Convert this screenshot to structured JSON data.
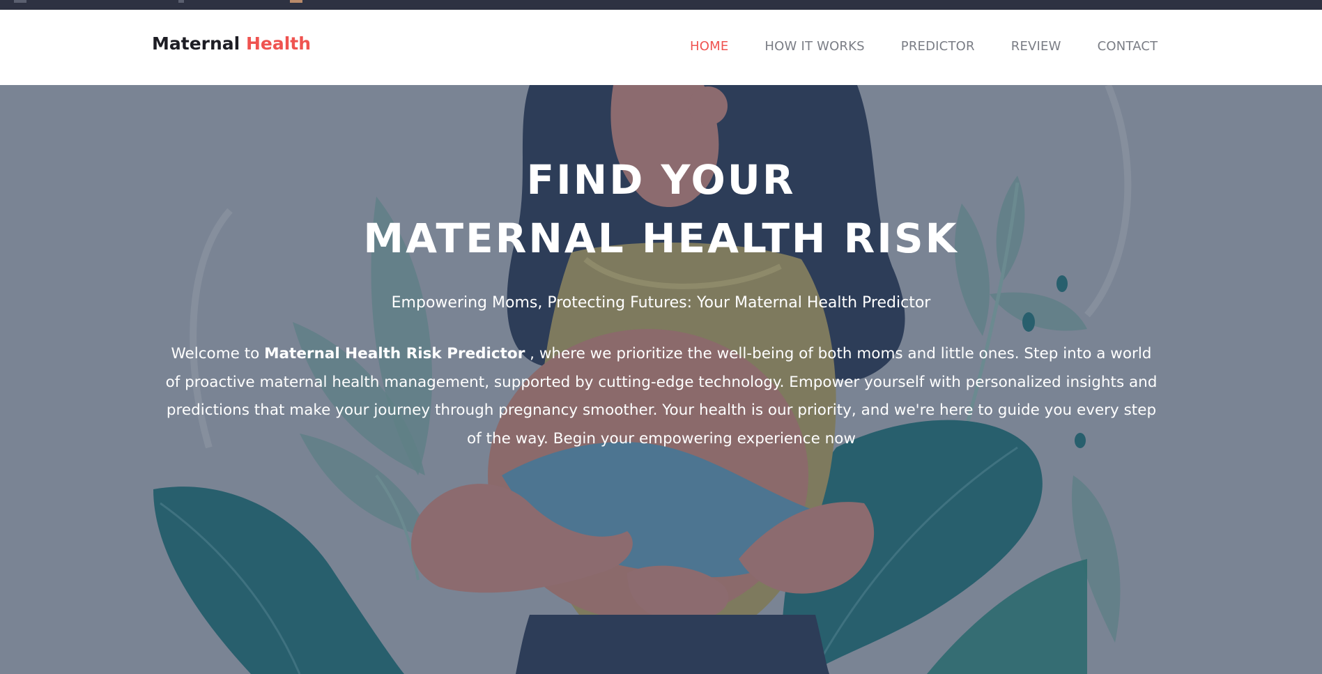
{
  "brand": {
    "name_part1": "Maternal",
    "name_part2": "Health"
  },
  "nav": {
    "items": [
      {
        "label": "HOME",
        "active": true
      },
      {
        "label": "HOW IT WORKS",
        "active": false
      },
      {
        "label": "PREDICTOR",
        "active": false
      },
      {
        "label": "REVIEW",
        "active": false
      },
      {
        "label": "CONTACT",
        "active": false
      }
    ]
  },
  "hero": {
    "title_line1": "FIND YOUR",
    "title_line2": "MATERNAL HEALTH RISK",
    "tagline": "Empowering Moms, Protecting Futures: Your Maternal Health Predictor",
    "intro_prefix": "Welcome to ",
    "intro_bold": "Maternal Health Risk Predictor",
    "intro_suffix": " , where we prioritize the well-being of both moms and little ones. Step into a world of proactive maternal health management, supported by cutting-edge technology. Empower yourself with personalized insights and predictions that make your journey through pregnancy smoother. Your health is our priority, and we're here to guide you every step of the way. Begin your empowering experience now"
  },
  "colors": {
    "accent": "#ef5350",
    "nav_text": "#7a7d85",
    "hero_overlay": "#7a8494",
    "brand_text": "#1d1d24"
  }
}
